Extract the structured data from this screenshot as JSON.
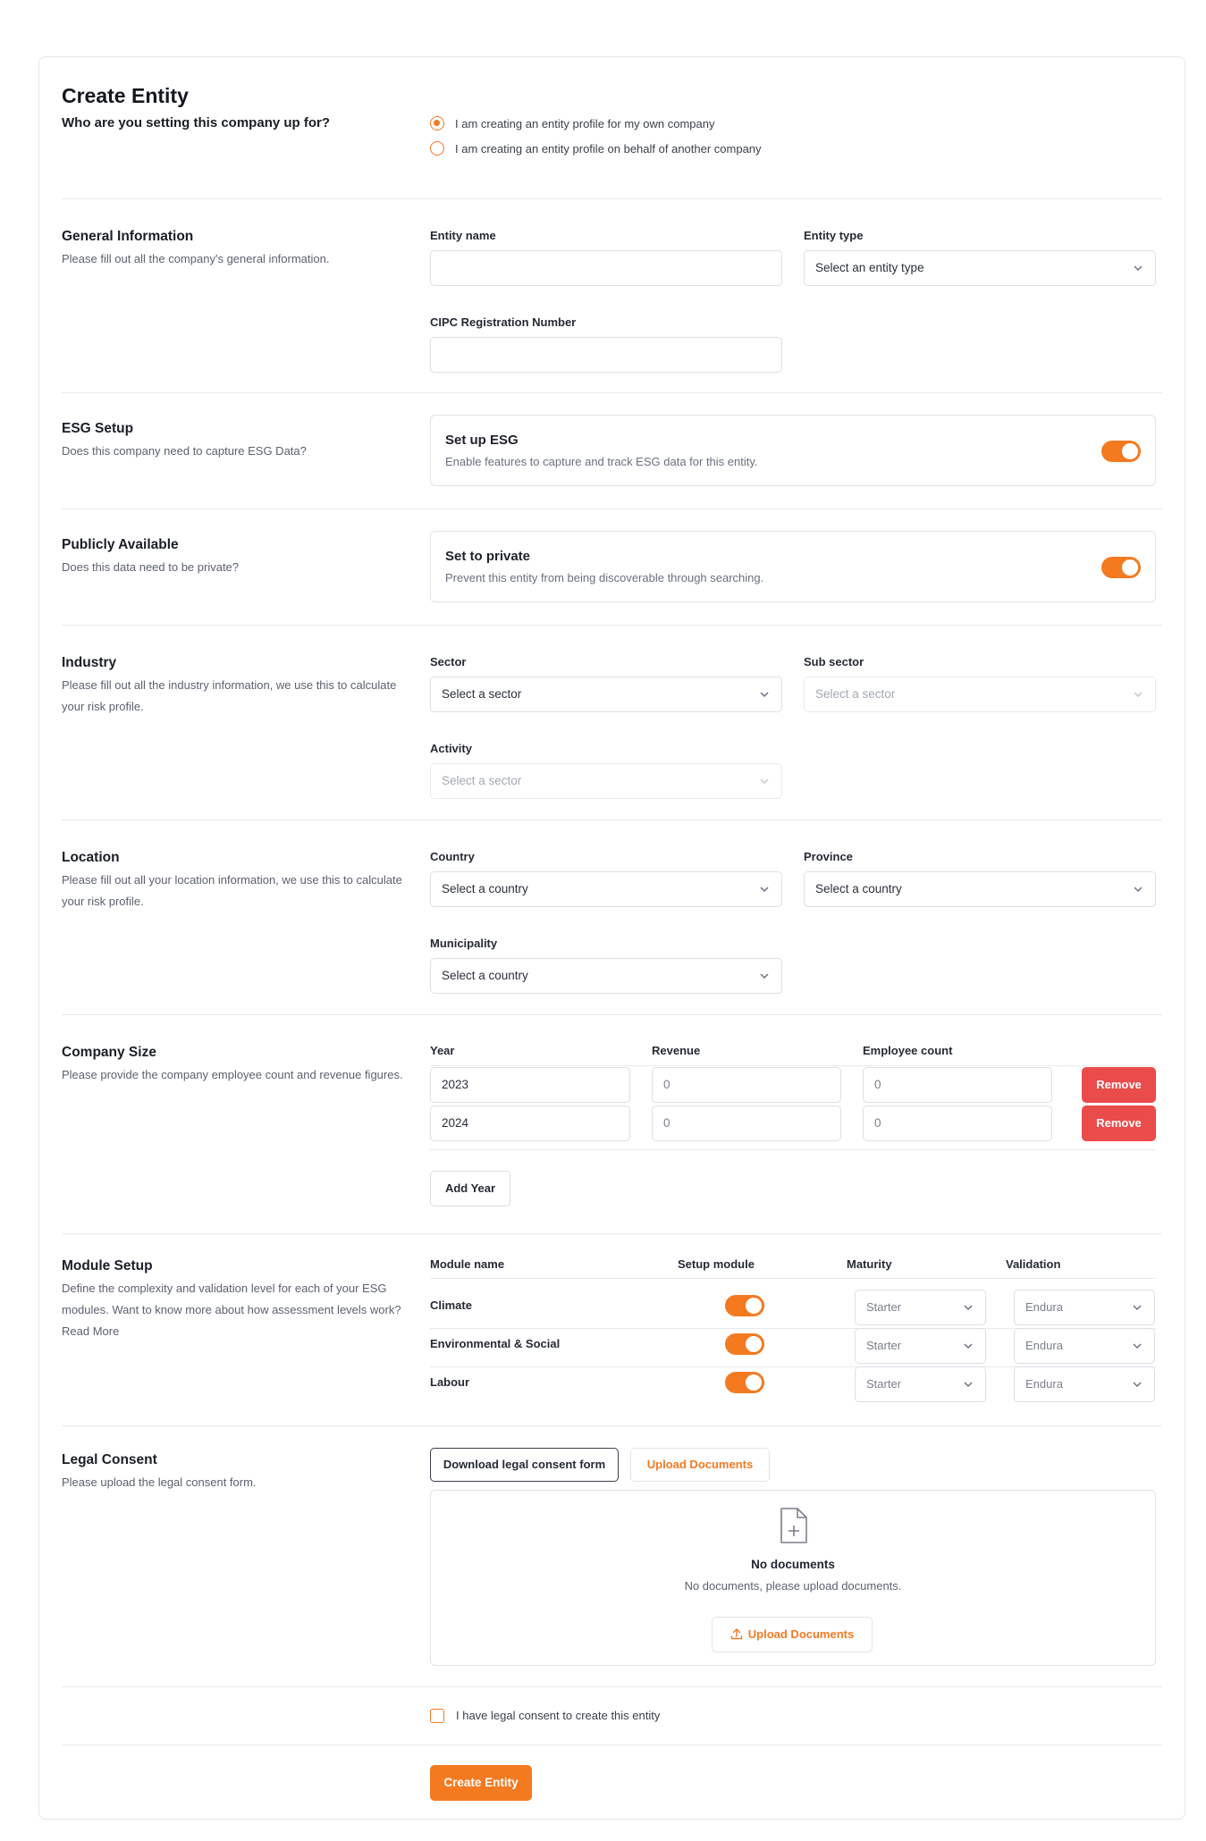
{
  "page": {
    "title": "Create Entity"
  },
  "who": {
    "question": "Who are you setting this company up for?",
    "option_own": "I am creating an entity profile for my own company",
    "option_other": "I am creating an entity profile on behalf of another company"
  },
  "general": {
    "title": "General Information",
    "desc": "Please fill out all the company's general information.",
    "entity_name_label": "Entity name",
    "entity_name_value": "",
    "entity_type_label": "Entity type",
    "entity_type_value": "Select an entity type",
    "cipc_label": "CIPC Registration Number",
    "cipc_value": ""
  },
  "esg": {
    "title": "ESG Setup",
    "desc": "Does this company need to capture ESG Data?",
    "box_title": "Set up ESG",
    "box_desc": "Enable features to capture and track ESG data for this entity.",
    "enabled": true
  },
  "public": {
    "title": "Publicly Available",
    "desc": "Does this data need to be private?",
    "box_title": "Set to private",
    "box_desc": "Prevent this entity from being discoverable through searching.",
    "enabled": true
  },
  "industry": {
    "title": "Industry",
    "desc": "Please fill out all the industry information, we use this to calculate your risk profile.",
    "sector_label": "Sector",
    "sector_value": "Select a sector",
    "subsector_label": "Sub sector",
    "subsector_value": "Select a sector",
    "activity_label": "Activity",
    "activity_value": "Select a sector"
  },
  "location": {
    "title": "Location",
    "desc": "Please fill out all your location information, we use this to calculate your risk profile.",
    "country_label": "Country",
    "country_value": "Select a country",
    "province_label": "Province",
    "province_value": "Select a country",
    "municipality_label": "Municipality",
    "municipality_value": "Select a country"
  },
  "size": {
    "title": "Company Size",
    "desc": "Please provide the company employee count and revenue figures.",
    "col_year": "Year",
    "col_revenue": "Revenue",
    "col_employees": "Employee count",
    "rows": [
      {
        "year": "2023",
        "revenue": "0",
        "employees": "0",
        "remove": "Remove"
      },
      {
        "year": "2024",
        "revenue": "0",
        "employees": "0",
        "remove": "Remove"
      }
    ],
    "add_year": "Add Year"
  },
  "modules": {
    "title": "Module Setup",
    "desc": "Define the complexity and validation level for each of your ESG modules. Want to know more about how assessment levels work? Read More",
    "col_name": "Module name",
    "col_setup": "Setup module",
    "col_maturity": "Maturity",
    "col_validation": "Validation",
    "rows": [
      {
        "name": "Climate",
        "enabled": true,
        "maturity": "Starter",
        "validation": "Endura"
      },
      {
        "name": "Environmental & Social",
        "enabled": true,
        "maturity": "Starter",
        "validation": "Endura"
      },
      {
        "name": "Labour",
        "enabled": true,
        "maturity": "Starter",
        "validation": "Endura"
      }
    ]
  },
  "legal": {
    "title": "Legal Consent",
    "desc": "Please upload the legal consent form.",
    "download_btn": "Download legal consent form",
    "upload_btn": "Upload Documents",
    "empty_title": "No documents",
    "empty_desc": "No documents, please upload documents.",
    "upload_btn2": "Upload Documents",
    "consent_label": "I have legal consent to create this entity"
  },
  "submit": {
    "label": "Create Entity"
  },
  "colors": {
    "accent": "#f47a20",
    "danger": "#ea4b4b"
  }
}
